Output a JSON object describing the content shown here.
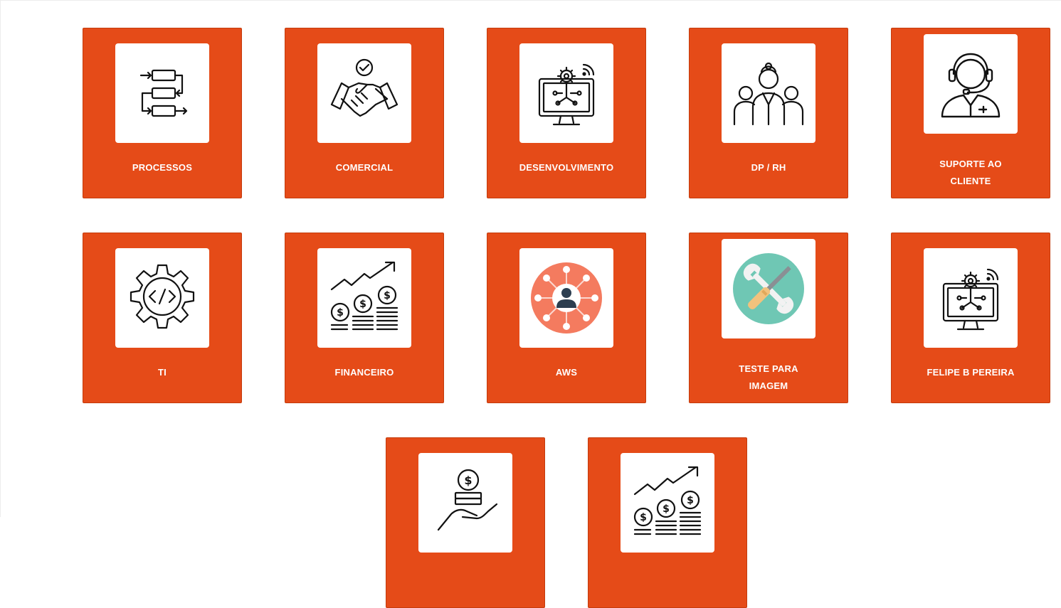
{
  "cards": [
    {
      "id": "processos",
      "lines": [
        "PROCESSOS"
      ],
      "icon": "flowchart-icon"
    },
    {
      "id": "comercial",
      "lines": [
        "COMERCIAL"
      ],
      "icon": "handshake-icon"
    },
    {
      "id": "desenvolvimento",
      "lines": [
        "DESENVOLVIMENTO"
      ],
      "icon": "monitor-gear-icon"
    },
    {
      "id": "dp-rh",
      "lines": [
        "DP / RH"
      ],
      "icon": "team-icon"
    },
    {
      "id": "suporte",
      "lines": [
        "SUPORTE AO",
        "CLIENTE"
      ],
      "icon": "headset-support-icon"
    },
    {
      "id": "ti",
      "lines": [
        "TI"
      ],
      "icon": "gear-code-icon"
    },
    {
      "id": "financeiro",
      "lines": [
        "FINANCEIRO"
      ],
      "icon": "coins-growth-icon"
    },
    {
      "id": "aws",
      "lines": [
        "AWS"
      ],
      "icon": "network-user-icon"
    },
    {
      "id": "teste",
      "lines": [
        "TESTE PARA",
        "IMAGEM"
      ],
      "icon": "tools-icon"
    },
    {
      "id": "felipe",
      "lines": [
        "FELIPE B PEREIRA"
      ],
      "icon": "monitor-gear-icon"
    },
    {
      "id": "extra-1",
      "lines": [],
      "icon": "hand-coin-icon"
    },
    {
      "id": "extra-2",
      "lines": [],
      "icon": "coins-growth-icon"
    }
  ],
  "colors": {
    "card": "#e54b18",
    "aws_circle": "#f47b5f",
    "tools_circle": "#6fc7b4"
  }
}
